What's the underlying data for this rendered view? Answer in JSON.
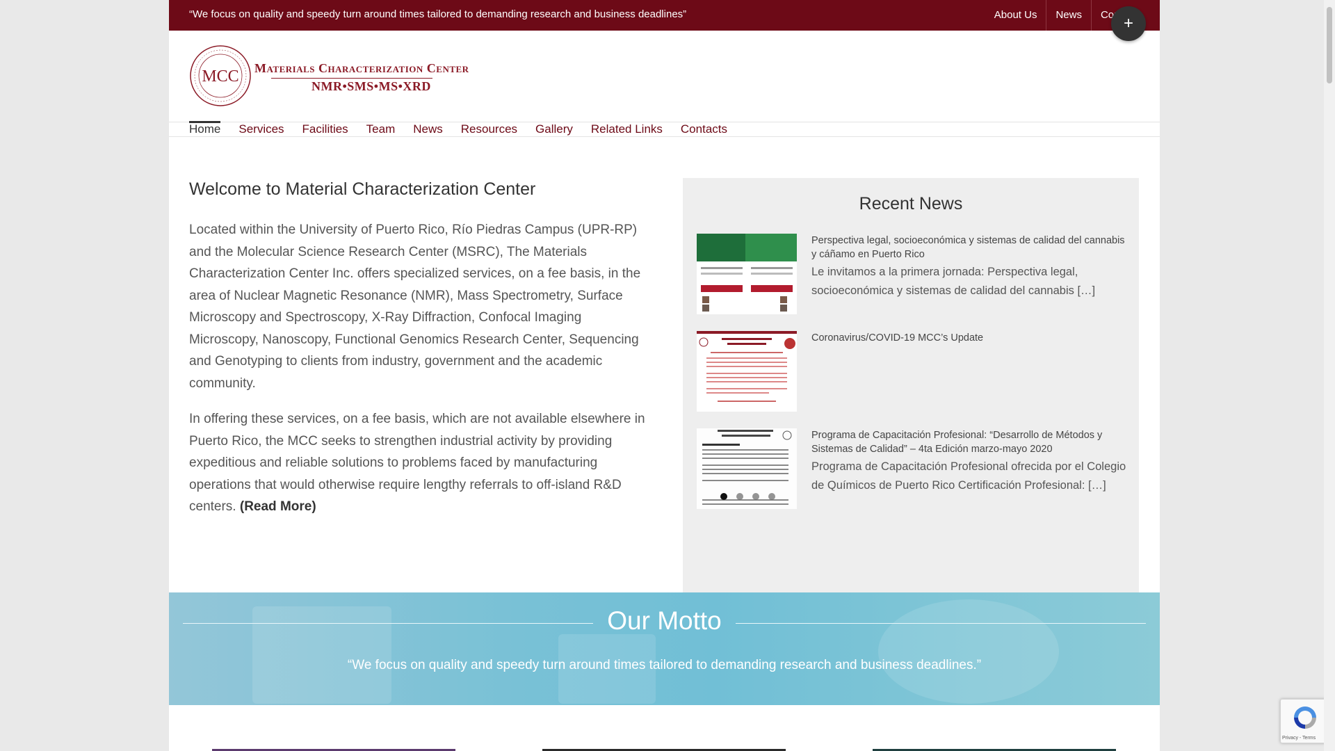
{
  "topbar": {
    "tagline": "“We focus on quality and speedy turn around times tailored to demanding research and business deadlines”",
    "links": [
      "About Us",
      "News",
      "Conta"
    ]
  },
  "toggle_symbol": "+",
  "logo": {
    "seal_text": "MCC",
    "name": "Materials Characterization Center",
    "sub": "NMR•SMS•MS•XRD"
  },
  "nav": {
    "items": [
      "Home",
      "Services",
      "Facilities",
      "Team",
      "News",
      "Resources",
      "Gallery",
      "Related Links",
      "Contacts"
    ],
    "active": "Home"
  },
  "welcome": {
    "title": "Welcome to Material Characterization Center",
    "p1": "Located within the University of Puerto Rico, Río Piedras Campus (UPR-RP) and the Molecular Science Research Center (MSRC), The Materials Characterization Center Inc. offers specialized services, on a fee basis, in the area of Nuclear Magnetic Resonance (NMR), Mass Spectrometry, Surface Microscopy and Spectroscopy, X-Ray Diffraction, Confocal Imaging Microscopy, Nanoscopy, Functional Genomics Research Center, Sequencing and Genotyping to clients from industry, government and the academic community.",
    "p2": "In offering these services, on a fee basis, which are not available elsewhere in Puerto Rico, the MCC seeks to strengthen industrial activity by providing expeditious and reliable solutions to problems faced by manufacturing operations that would otherwise require lengthy referrals to off-island R&D centers.",
    "read_more": "(Read More)"
  },
  "recent_news": {
    "title": "Recent News",
    "items": [
      {
        "title": "Perspectiva legal, socioeconómica y sistemas de calidad del cannabis y cáñamo en Puerto Rico",
        "excerpt": "Le invitamos a la primera jornada: Perspectiva legal, socioeconómica y sistemas de calidad del cannabis […]"
      },
      {
        "title": "Coronavirus/COVID-19 MCC’s Update",
        "excerpt": ""
      },
      {
        "title": "Programa de Capacitación Profesional: “Desarrollo de Métodos y Sistemas de Calidad” – 4ta Edición marzo-mayo 2020",
        "excerpt": "Programa de Capacitación Profesional ofrecida por el Colegio de Químicos de Puerto Rico Certificación Profesional: […]"
      }
    ]
  },
  "motto": {
    "title": "Our Motto",
    "text": "“We focus on quality and speedy turn around times tailored to demanding research and business deadlines.”"
  },
  "recaptcha": {
    "text": "Privacy - Terms"
  },
  "colors": {
    "brand": "#6d0a17",
    "motto_bg": "#79c1d6",
    "news_bg": "#eeeeee"
  }
}
